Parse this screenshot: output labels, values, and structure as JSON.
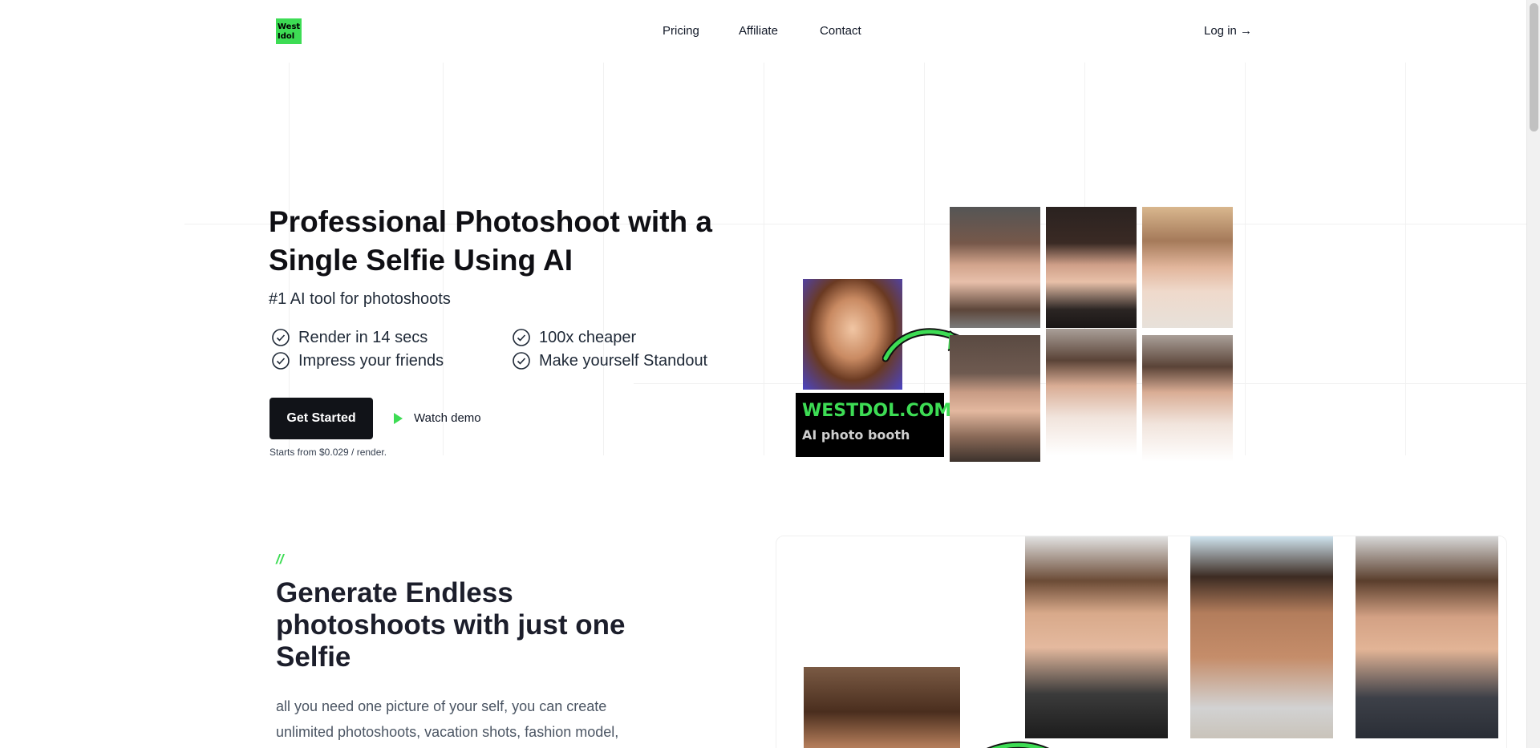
{
  "nav": {
    "logo": "West Idol",
    "links": [
      "Pricing",
      "Affiliate",
      "Contact"
    ],
    "login": "Log in →"
  },
  "hero": {
    "title": "Professional Photoshoot with a Single Selfie Using AI",
    "subtitle": "#1 AI tool for photoshoots",
    "features": [
      "Render in 14 secs",
      "100x cheaper",
      "Impress your friends",
      "Make yourself Standout"
    ],
    "cta": "Get Started",
    "demo": "Watch demo",
    "price_note": "Starts from $0.029 / render.",
    "booth_line1": "WESTDOL.COM",
    "booth_line2": "AI photo booth"
  },
  "section2": {
    "marker": "//",
    "title": "Generate Endless photoshoots with just one Selfie",
    "body": "all you need one picture of your self, you can create unlimited photoshoots, vacation shots, fashion model,"
  },
  "colors": {
    "accent": "#3ddc54",
    "dark": "#111318"
  }
}
